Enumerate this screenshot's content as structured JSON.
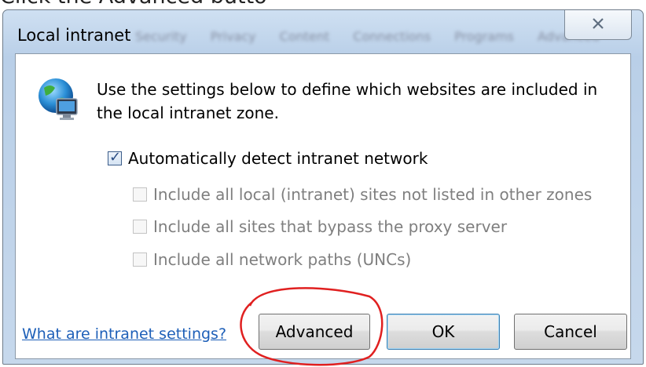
{
  "window": {
    "title": "Local intranet",
    "close_label": "X",
    "background_tabs": [
      "Security",
      "Privacy",
      "Content",
      "Connections",
      "Programs",
      "Advanced"
    ]
  },
  "top_snippet": "Click the Advanced butto",
  "description": "Use the settings below to define which websites are included in the local intranet zone.",
  "options": [
    {
      "label": "Automatically detect intranet network",
      "checked": true,
      "enabled": true
    },
    {
      "label": "Include all local (intranet) sites not listed in other zones",
      "checked": false,
      "enabled": false
    },
    {
      "label": "Include all sites that bypass the proxy server",
      "checked": false,
      "enabled": false
    },
    {
      "label": "Include all network paths (UNCs)",
      "checked": false,
      "enabled": false
    }
  ],
  "link_text": "What are intranet settings?",
  "buttons": {
    "advanced": "Advanced",
    "ok": "OK",
    "cancel": "Cancel"
  },
  "colors": {
    "link": "#1d5fb8",
    "annotation": "#e02020"
  },
  "icons": {
    "zone": "globe-monitor-icon",
    "close": "close-icon"
  }
}
